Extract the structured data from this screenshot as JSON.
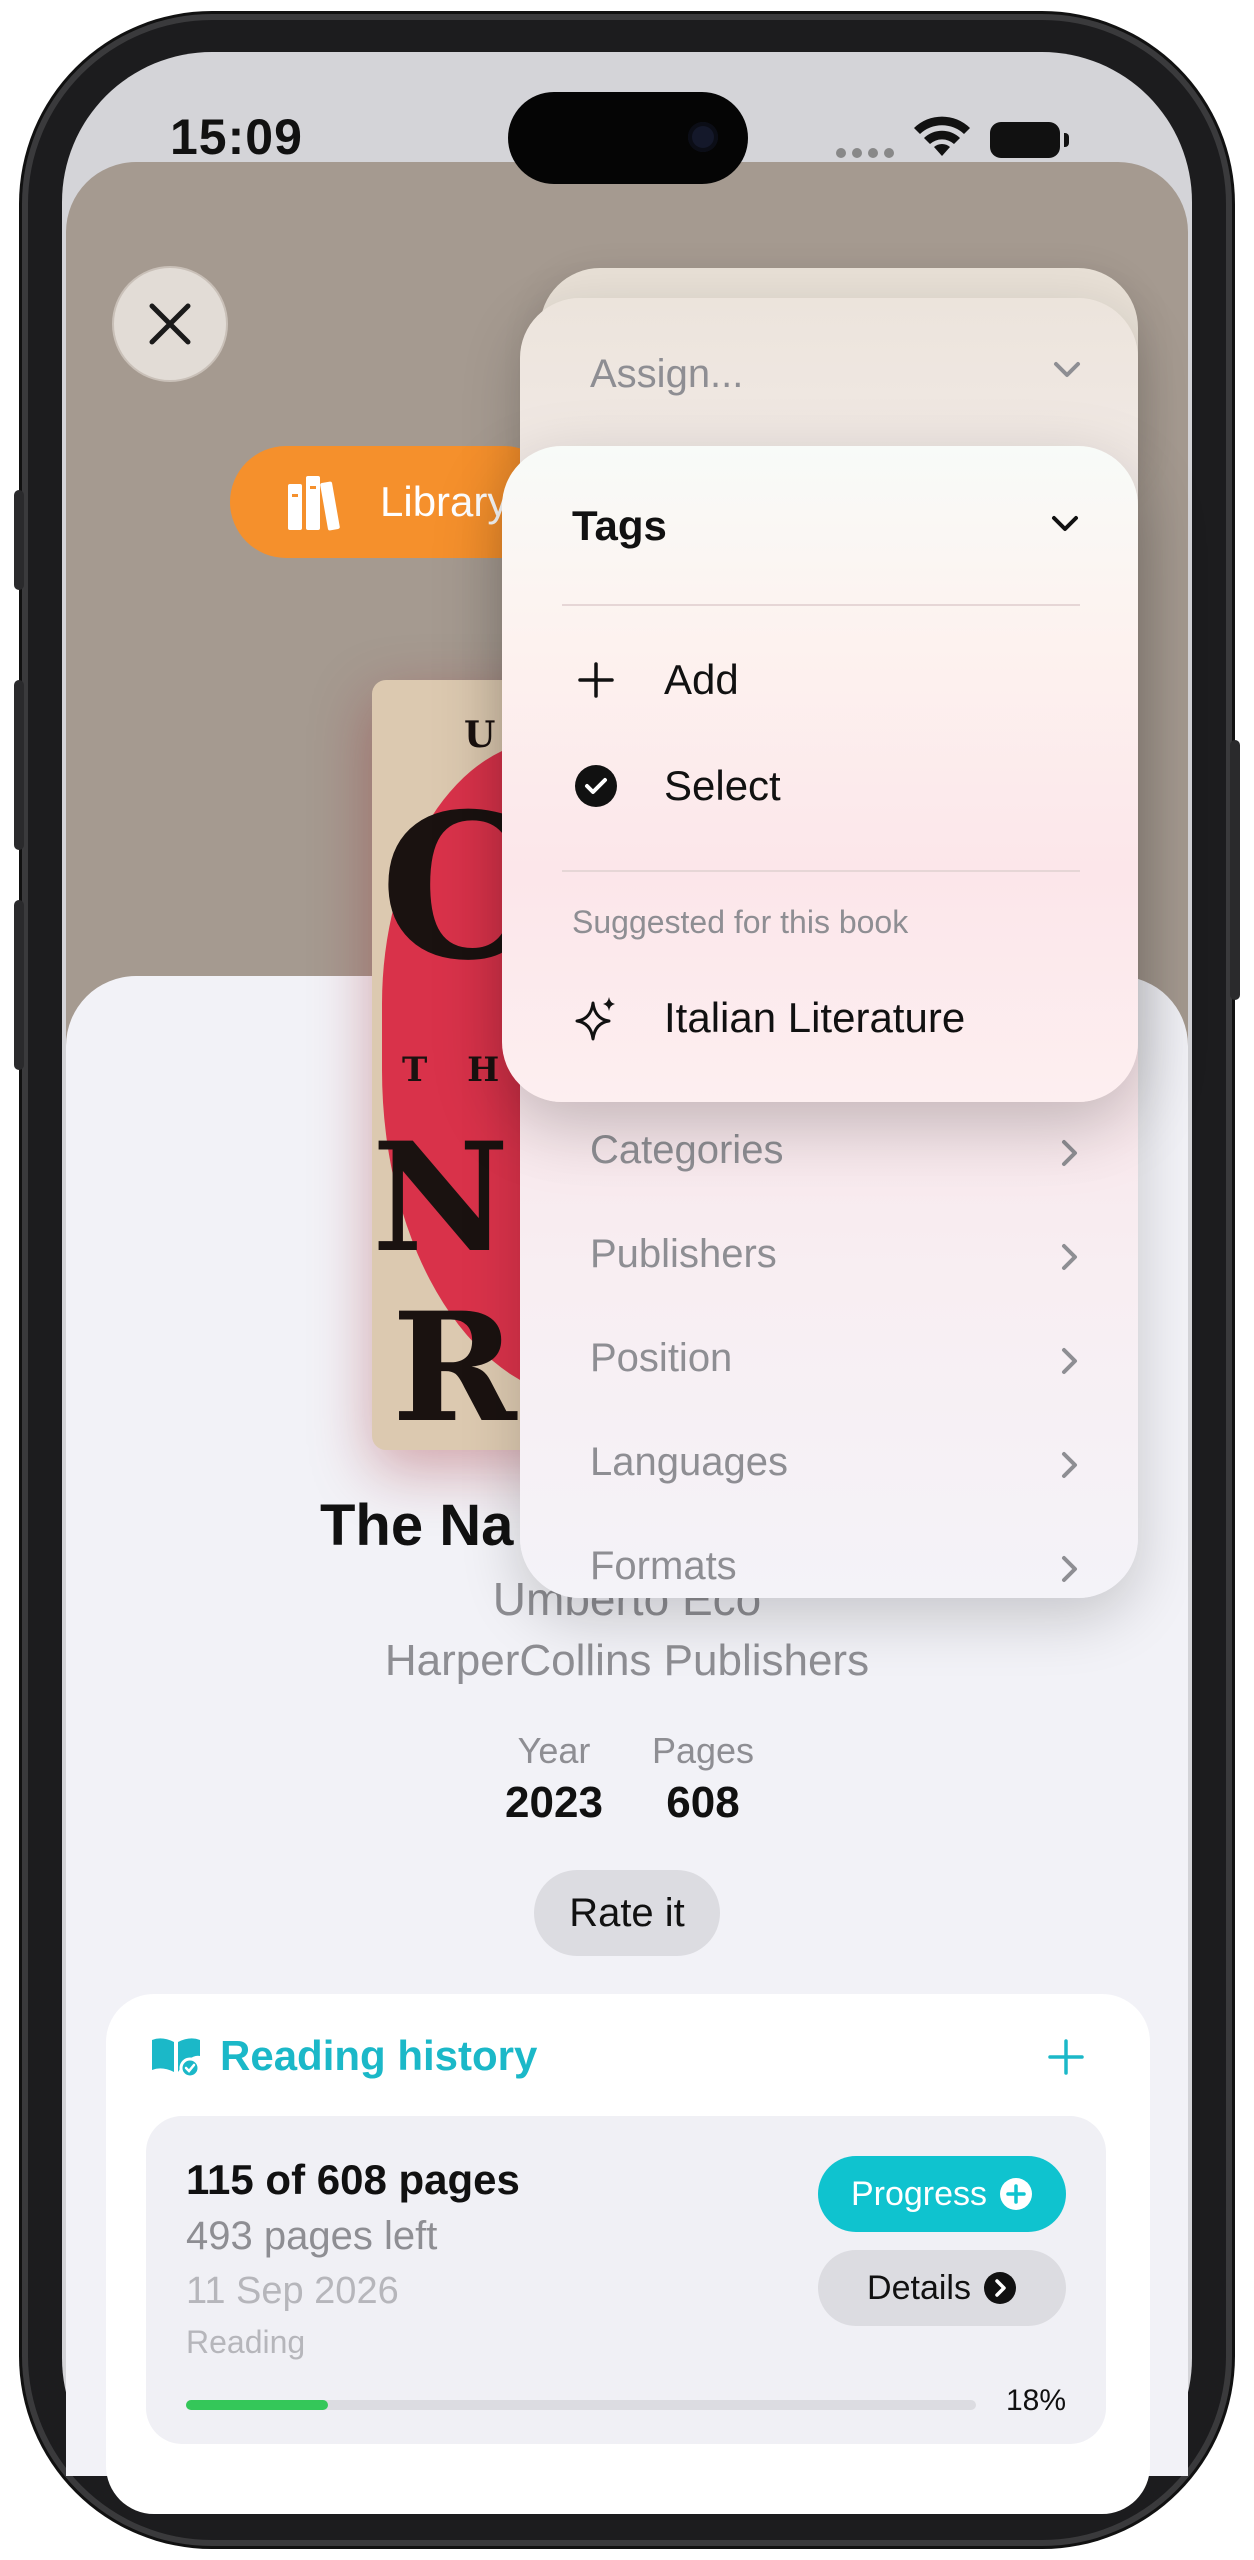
{
  "status_bar": {
    "time": "15:09"
  },
  "library_badge": {
    "label": "Library",
    "color": "#f5902c"
  },
  "book": {
    "title": "The Na",
    "author": "Umberto Eco",
    "publisher": "HarperCollins Publishers",
    "year_label": "Year",
    "year": "2023",
    "pages_label": "Pages",
    "pages": "608",
    "cover_letters": [
      "U",
      "C",
      "T H",
      "N",
      "R"
    ]
  },
  "rate_button": "Rate it",
  "menu": {
    "assign_label": "Assign...",
    "tags": {
      "title": "Tags",
      "items": [
        {
          "label": "Add",
          "icon": "plus-icon"
        },
        {
          "label": "Select",
          "icon": "checkmark-circle-icon"
        }
      ],
      "suggested_heading": "Suggested for this book",
      "suggestions": [
        {
          "label": "Italian Literature",
          "icon": "sparkles-icon"
        }
      ]
    },
    "submenus": [
      "Categories",
      "Publishers",
      "Position",
      "Languages",
      "Formats"
    ]
  },
  "reading_history": {
    "title": "Reading history",
    "accent": "#1bb8c8",
    "summary": "115 of 608 pages",
    "remaining": "493 pages left",
    "date": "11 Sep 2026",
    "status": "Reading",
    "progress_button": "Progress",
    "details_button": "Details",
    "progress_fraction": 0.18,
    "progress_percent": "18%"
  }
}
